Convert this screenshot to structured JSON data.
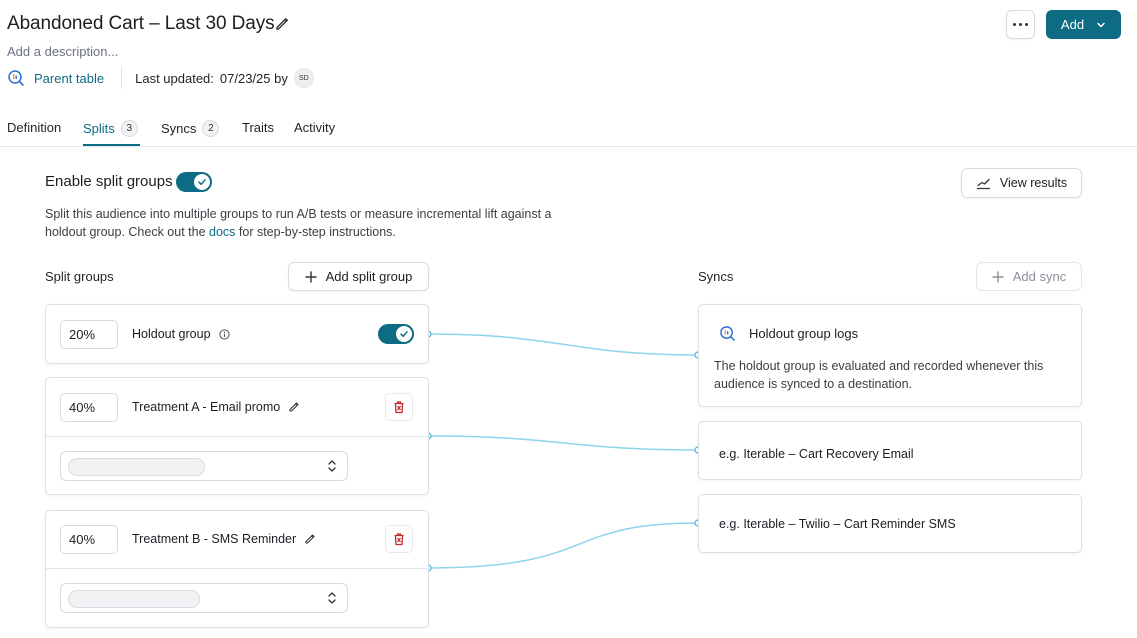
{
  "header": {
    "title": "Abandoned Cart – Last 30 Days",
    "description_placeholder": "Add a description...",
    "parent_link": "Parent table",
    "last_updated_label": "Last updated:",
    "last_updated_value": "07/23/25 by",
    "avatar_initials": "SD",
    "add_label": "Add"
  },
  "tabs": [
    {
      "label": "Definition"
    },
    {
      "label": "Splits",
      "count": "3"
    },
    {
      "label": "Syncs",
      "count": "2"
    },
    {
      "label": "Traits"
    },
    {
      "label": "Activity"
    }
  ],
  "split": {
    "enable_label": "Enable split groups",
    "enabled": true,
    "intro_before_link": "Split this audience into multiple groups to run A/B tests or measure incremental lift against a holdout group. Check out the ",
    "intro_link": "docs",
    "intro_after_link": " for step-by-step instructions.",
    "view_results_label": "View results",
    "groups_label": "Split groups",
    "add_group_label": "Add split group",
    "syncs_label": "Syncs",
    "add_sync_label": "Add sync"
  },
  "groups": [
    {
      "percent": "20%",
      "name": "Holdout group",
      "holdout_enabled": true
    },
    {
      "percent": "40%",
      "name": "Treatment A - Email promo"
    },
    {
      "percent": "40%",
      "name": "Treatment B - SMS Reminder"
    }
  ],
  "syncs": [
    {
      "title": "Holdout group logs",
      "description": "The holdout group is evaluated and recorded whenever this audience is synced to a destination."
    },
    {
      "placeholder": "e.g. Iterable – Cart Recovery Email"
    },
    {
      "placeholder": "e.g. Iterable – Twilio – Cart Reminder SMS"
    }
  ],
  "colors": {
    "accent": "#0e6b84",
    "connector": "#8fd3ea",
    "danger": "#c62828"
  }
}
